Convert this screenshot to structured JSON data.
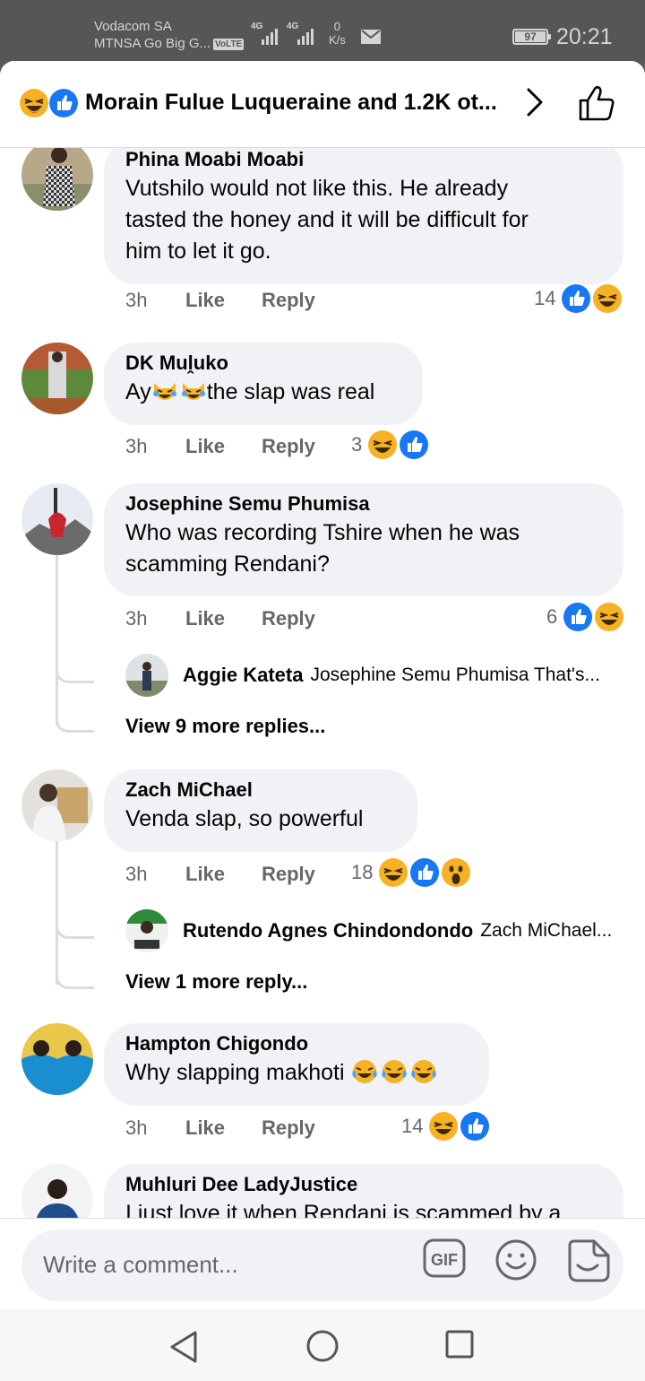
{
  "status_bar": {
    "carrier_1": "Vodacom SA",
    "carrier_2": "MTNSA Go Big G...",
    "volte": "VoLTE",
    "net_1": "4G",
    "net_2": "4G",
    "speed_value": "0",
    "speed_unit": "K/s",
    "battery": "97",
    "time": "20:21"
  },
  "header": {
    "title": "Morain Fulue Luqueraine and 1.2K ot...",
    "reaction_icons": [
      "haha-icon",
      "like-icon"
    ]
  },
  "comments": [
    {
      "author": "Phina Moabi Moabi",
      "text": "Vutshilo would not like this. He already\ntasted the honey and it will be difficult for\nhim to let it go.",
      "time": "3h",
      "like": "Like",
      "reply": "Reply",
      "reaction_count": "14",
      "reactions": [
        "like",
        "haha"
      ]
    },
    {
      "author": "DK Muḽuko",
      "text_prefix": "Ay",
      "text_suffix": "the slap was real",
      "inline_emoji": [
        "laughing-cat",
        "laughing-cat"
      ],
      "time": "3h",
      "like": "Like",
      "reply": "Reply",
      "reaction_count": "3",
      "reactions": [
        "haha",
        "like"
      ]
    },
    {
      "author": "Josephine Semu Phumisa",
      "text": "Who was recording Tshire when he was\nscamming Rendani?",
      "time": "3h",
      "like": "Like",
      "reply": "Reply",
      "reaction_count": "6",
      "reactions": [
        "like",
        "haha"
      ],
      "reply_preview": {
        "author": "Aggie Kateta",
        "text": "Josephine Semu Phumisa That's..."
      },
      "view_more": "View 9 more replies..."
    },
    {
      "author": "Zach MiChael",
      "text": "Venda slap, so powerful",
      "time": "3h",
      "like": "Like",
      "reply": "Reply",
      "reaction_count": "18",
      "reactions": [
        "haha",
        "like",
        "wow"
      ],
      "reply_preview": {
        "author": "Rutendo Agnes Chindondondo",
        "text": "Zach MiChael..."
      },
      "view_more": "View 1 more reply..."
    },
    {
      "author": "Hampton Chigondo",
      "text_prefix": "Why slapping makhoti ",
      "inline_emoji": [
        "tears-of-joy",
        "tears-of-joy",
        "tears-of-joy"
      ],
      "time": "3h",
      "like": "Like",
      "reply": "Reply",
      "reaction_count": "14",
      "reactions": [
        "haha",
        "like"
      ]
    },
    {
      "author": "Muhluri Dee LadyJustice",
      "text": "I just love it when Rendani is scammed by a"
    }
  ],
  "composer": {
    "placeholder": "Write a comment...",
    "gif": "GIF"
  },
  "colors": {
    "like_blue": "#1877f2",
    "haha_yellow": "#f7b125",
    "bubble": "#f0f2f5",
    "meta_gray": "#65676b"
  }
}
